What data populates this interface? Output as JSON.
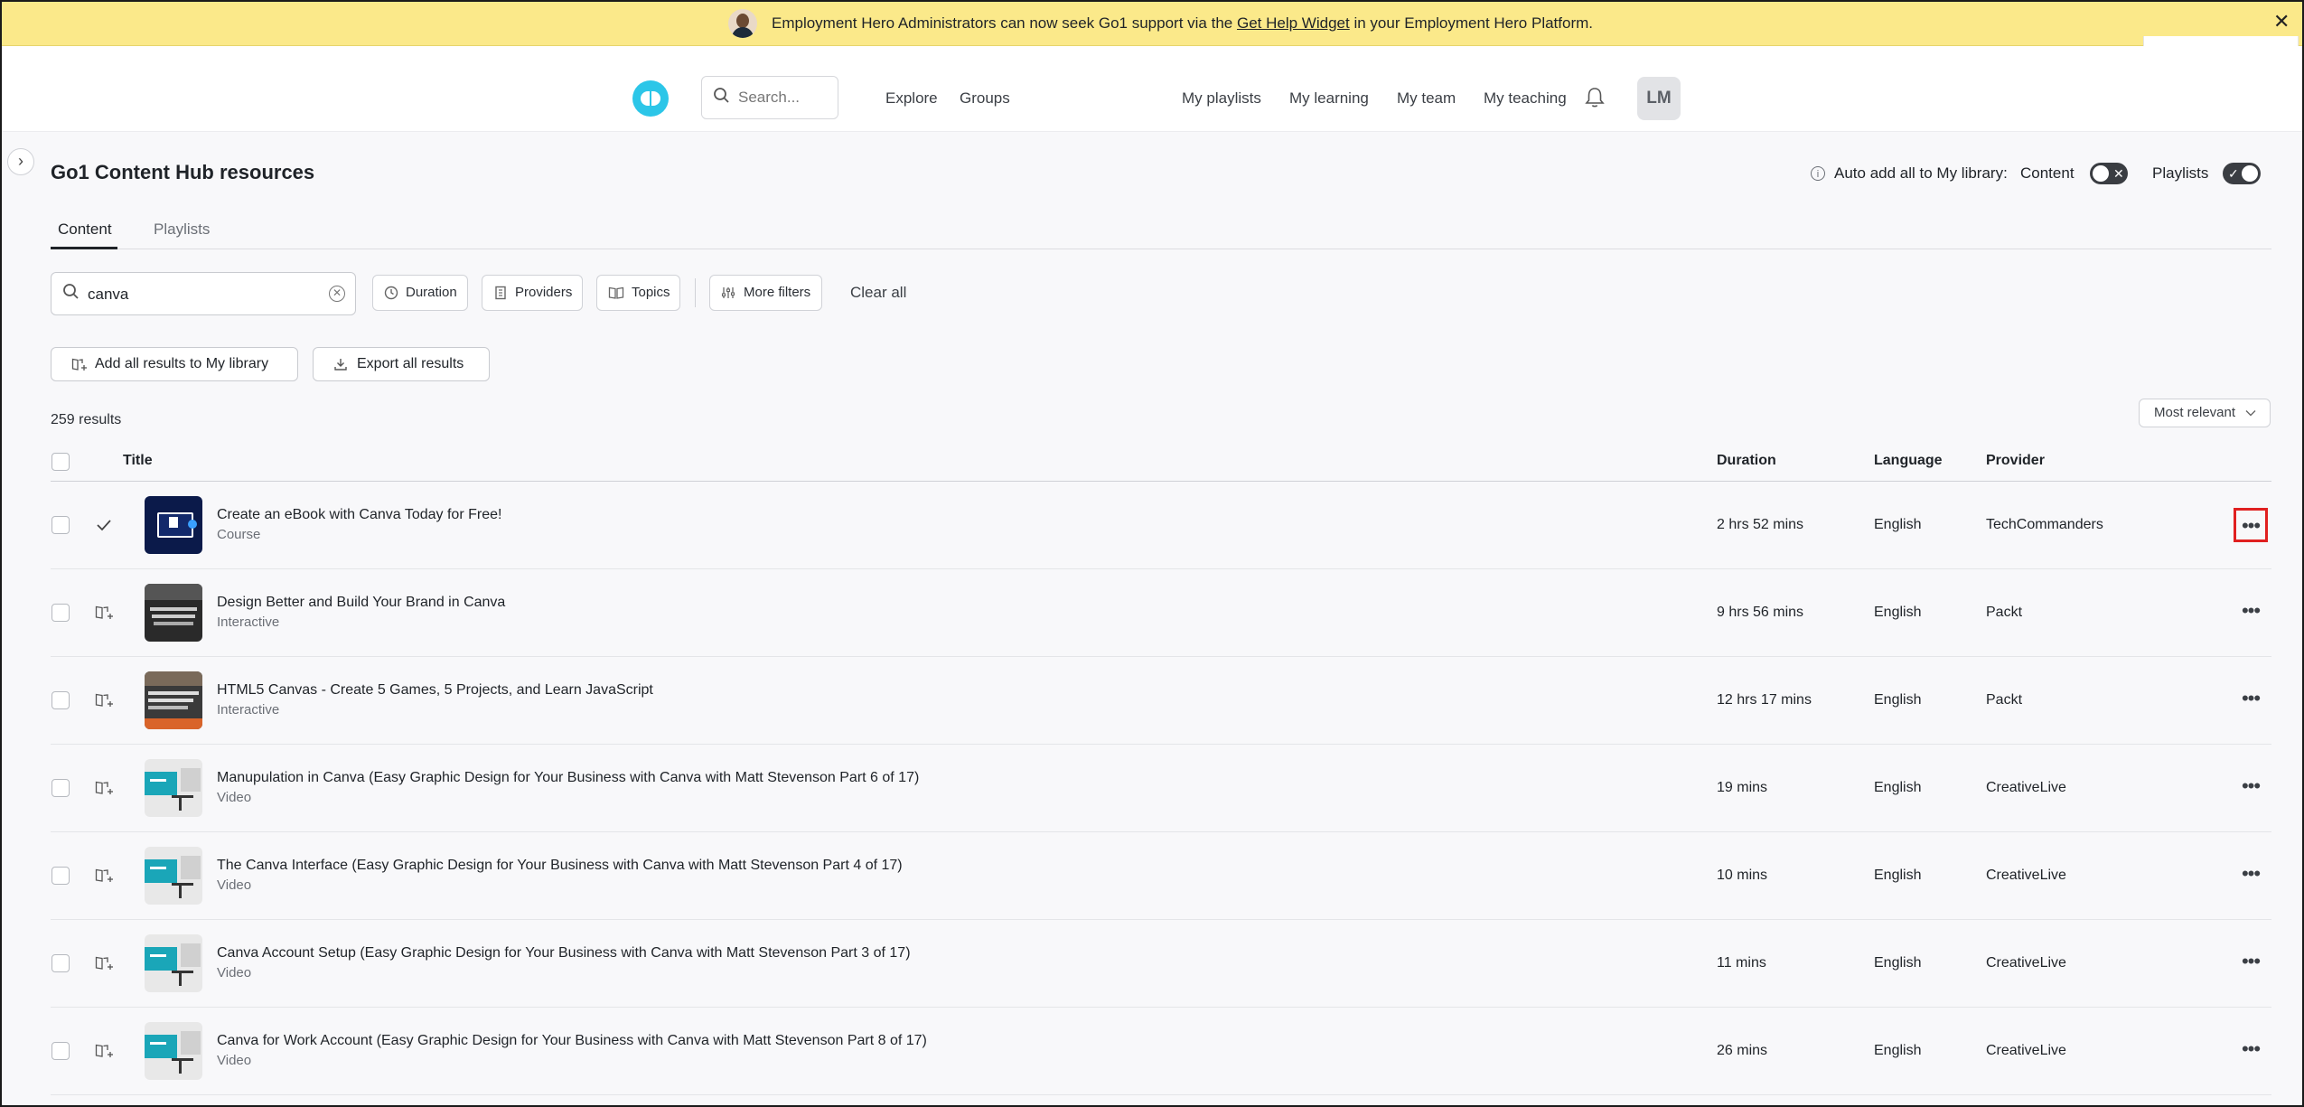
{
  "banner": {
    "message_prefix": "Employment Hero Administrators can now seek Go1 support via the",
    "link": "Get Help Widget",
    "message_suffix": "in your Employment Hero Platform.",
    "close": "✕"
  },
  "header": {
    "search_placeholder": "Search...",
    "nav_left": [
      "Explore",
      "Groups"
    ],
    "nav_right": [
      "My playlists",
      "My learning",
      "My team",
      "My teaching"
    ],
    "avatar": "LM"
  },
  "page": {
    "title": "Go1 Content Hub resources",
    "auto_add_label": "Auto add all to My library:",
    "toggle_content": "Content",
    "toggle_playlists": "Playlists",
    "side_toggle": "›"
  },
  "tabs": [
    "Content",
    "Playlists"
  ],
  "filters": {
    "search_value": "canva",
    "duration": "Duration",
    "providers": "Providers",
    "topics": "Topics",
    "more_filters": "More filters",
    "clear_all": "Clear all"
  },
  "actions": {
    "add_all": "Add all results to My library",
    "export_all": "Export all results"
  },
  "results": {
    "count": "259 results",
    "sort": "Most relevant"
  },
  "table": {
    "headers": {
      "title": "Title",
      "duration": "Duration",
      "language": "Language",
      "provider": "Provider"
    },
    "rows": [
      {
        "title": "Create an eBook with Canva Today for Free!",
        "type": "Course",
        "duration": "2 hrs 52 mins",
        "language": "English",
        "provider": "TechCommanders",
        "added": true
      },
      {
        "title": "Design Better and Build Your Brand in Canva",
        "type": "Interactive",
        "duration": "9 hrs 56 mins",
        "language": "English",
        "provider": "Packt",
        "added": false
      },
      {
        "title": "HTML5 Canvas - Create 5 Games, 5 Projects, and Learn JavaScript",
        "type": "Interactive",
        "duration": "12 hrs 17 mins",
        "language": "English",
        "provider": "Packt",
        "added": false
      },
      {
        "title": "Manupulation in Canva (Easy Graphic Design for Your Business with Canva with Matt Stevenson Part 6 of 17)",
        "type": "Video",
        "duration": "19 mins",
        "language": "English",
        "provider": "CreativeLive",
        "added": false
      },
      {
        "title": "The Canva Interface (Easy Graphic Design for Your Business with Canva with Matt Stevenson Part 4 of 17)",
        "type": "Video",
        "duration": "10 mins",
        "language": "English",
        "provider": "CreativeLive",
        "added": false
      },
      {
        "title": "Canva Account Setup (Easy Graphic Design for Your Business with Canva with Matt Stevenson Part 3 of 17)",
        "type": "Video",
        "duration": "11 mins",
        "language": "English",
        "provider": "CreativeLive",
        "added": false
      },
      {
        "title": "Canva for Work Account (Easy Graphic Design for Your Business with Canva with Matt Stevenson Part 8 of 17)",
        "type": "Video",
        "duration": "26 mins",
        "language": "English",
        "provider": "CreativeLive",
        "added": false
      }
    ]
  },
  "colors": {
    "banner": "#fbe98a",
    "brand": "#2cc6e8",
    "highlight": "#e02020",
    "toggle": "#3a3d42"
  }
}
